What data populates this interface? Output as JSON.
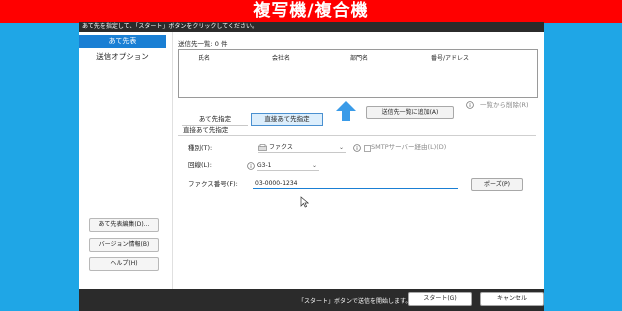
{
  "banner": {
    "title": "複写機/複合機"
  },
  "instruction": "あて先を指定して、「スタート」ボタンをクリックしてください。",
  "sidebar": {
    "tabs": [
      "あて先表",
      "送信オプション"
    ],
    "buttons": [
      "あて先表編集(D)...",
      "バージョン情報(B)",
      "ヘルプ(H)"
    ]
  },
  "recipients": {
    "header": "送信先一覧: 0 件",
    "columns": [
      "氏名",
      "会社名",
      "部門名",
      "番号/アドレス"
    ],
    "add_button": "送信先一覧に追加(A)",
    "remove_link": "一覧から削除(R)"
  },
  "mode_tabs": [
    "あて先指定",
    "直接あて先指定"
  ],
  "direct": {
    "section_label": "直接あて先指定",
    "type_label": "種別(T):",
    "type_value": "ファクス",
    "smtp_label": "SMTPサーバー経由(L)(D)",
    "line_label": "回線(L):",
    "line_value": "G3-1",
    "fax_label": "ファクス番号(F):",
    "fax_value": "03-0000-1234",
    "pause_button": "ポーズ(P)"
  },
  "footer": {
    "message": "「スタート」ボタンで送信を開始します。",
    "start_button": "スタート(G)",
    "cancel_button": "キャンセル"
  },
  "colors": {
    "banner": "#ff0000",
    "background": "#1fa6e6",
    "accent": "#1a7fd4",
    "arrow": "#3a9be8"
  },
  "icons": [
    "info-icon",
    "fax-icon",
    "chevron-down-icon",
    "up-arrow-icon",
    "cursor-icon"
  ]
}
